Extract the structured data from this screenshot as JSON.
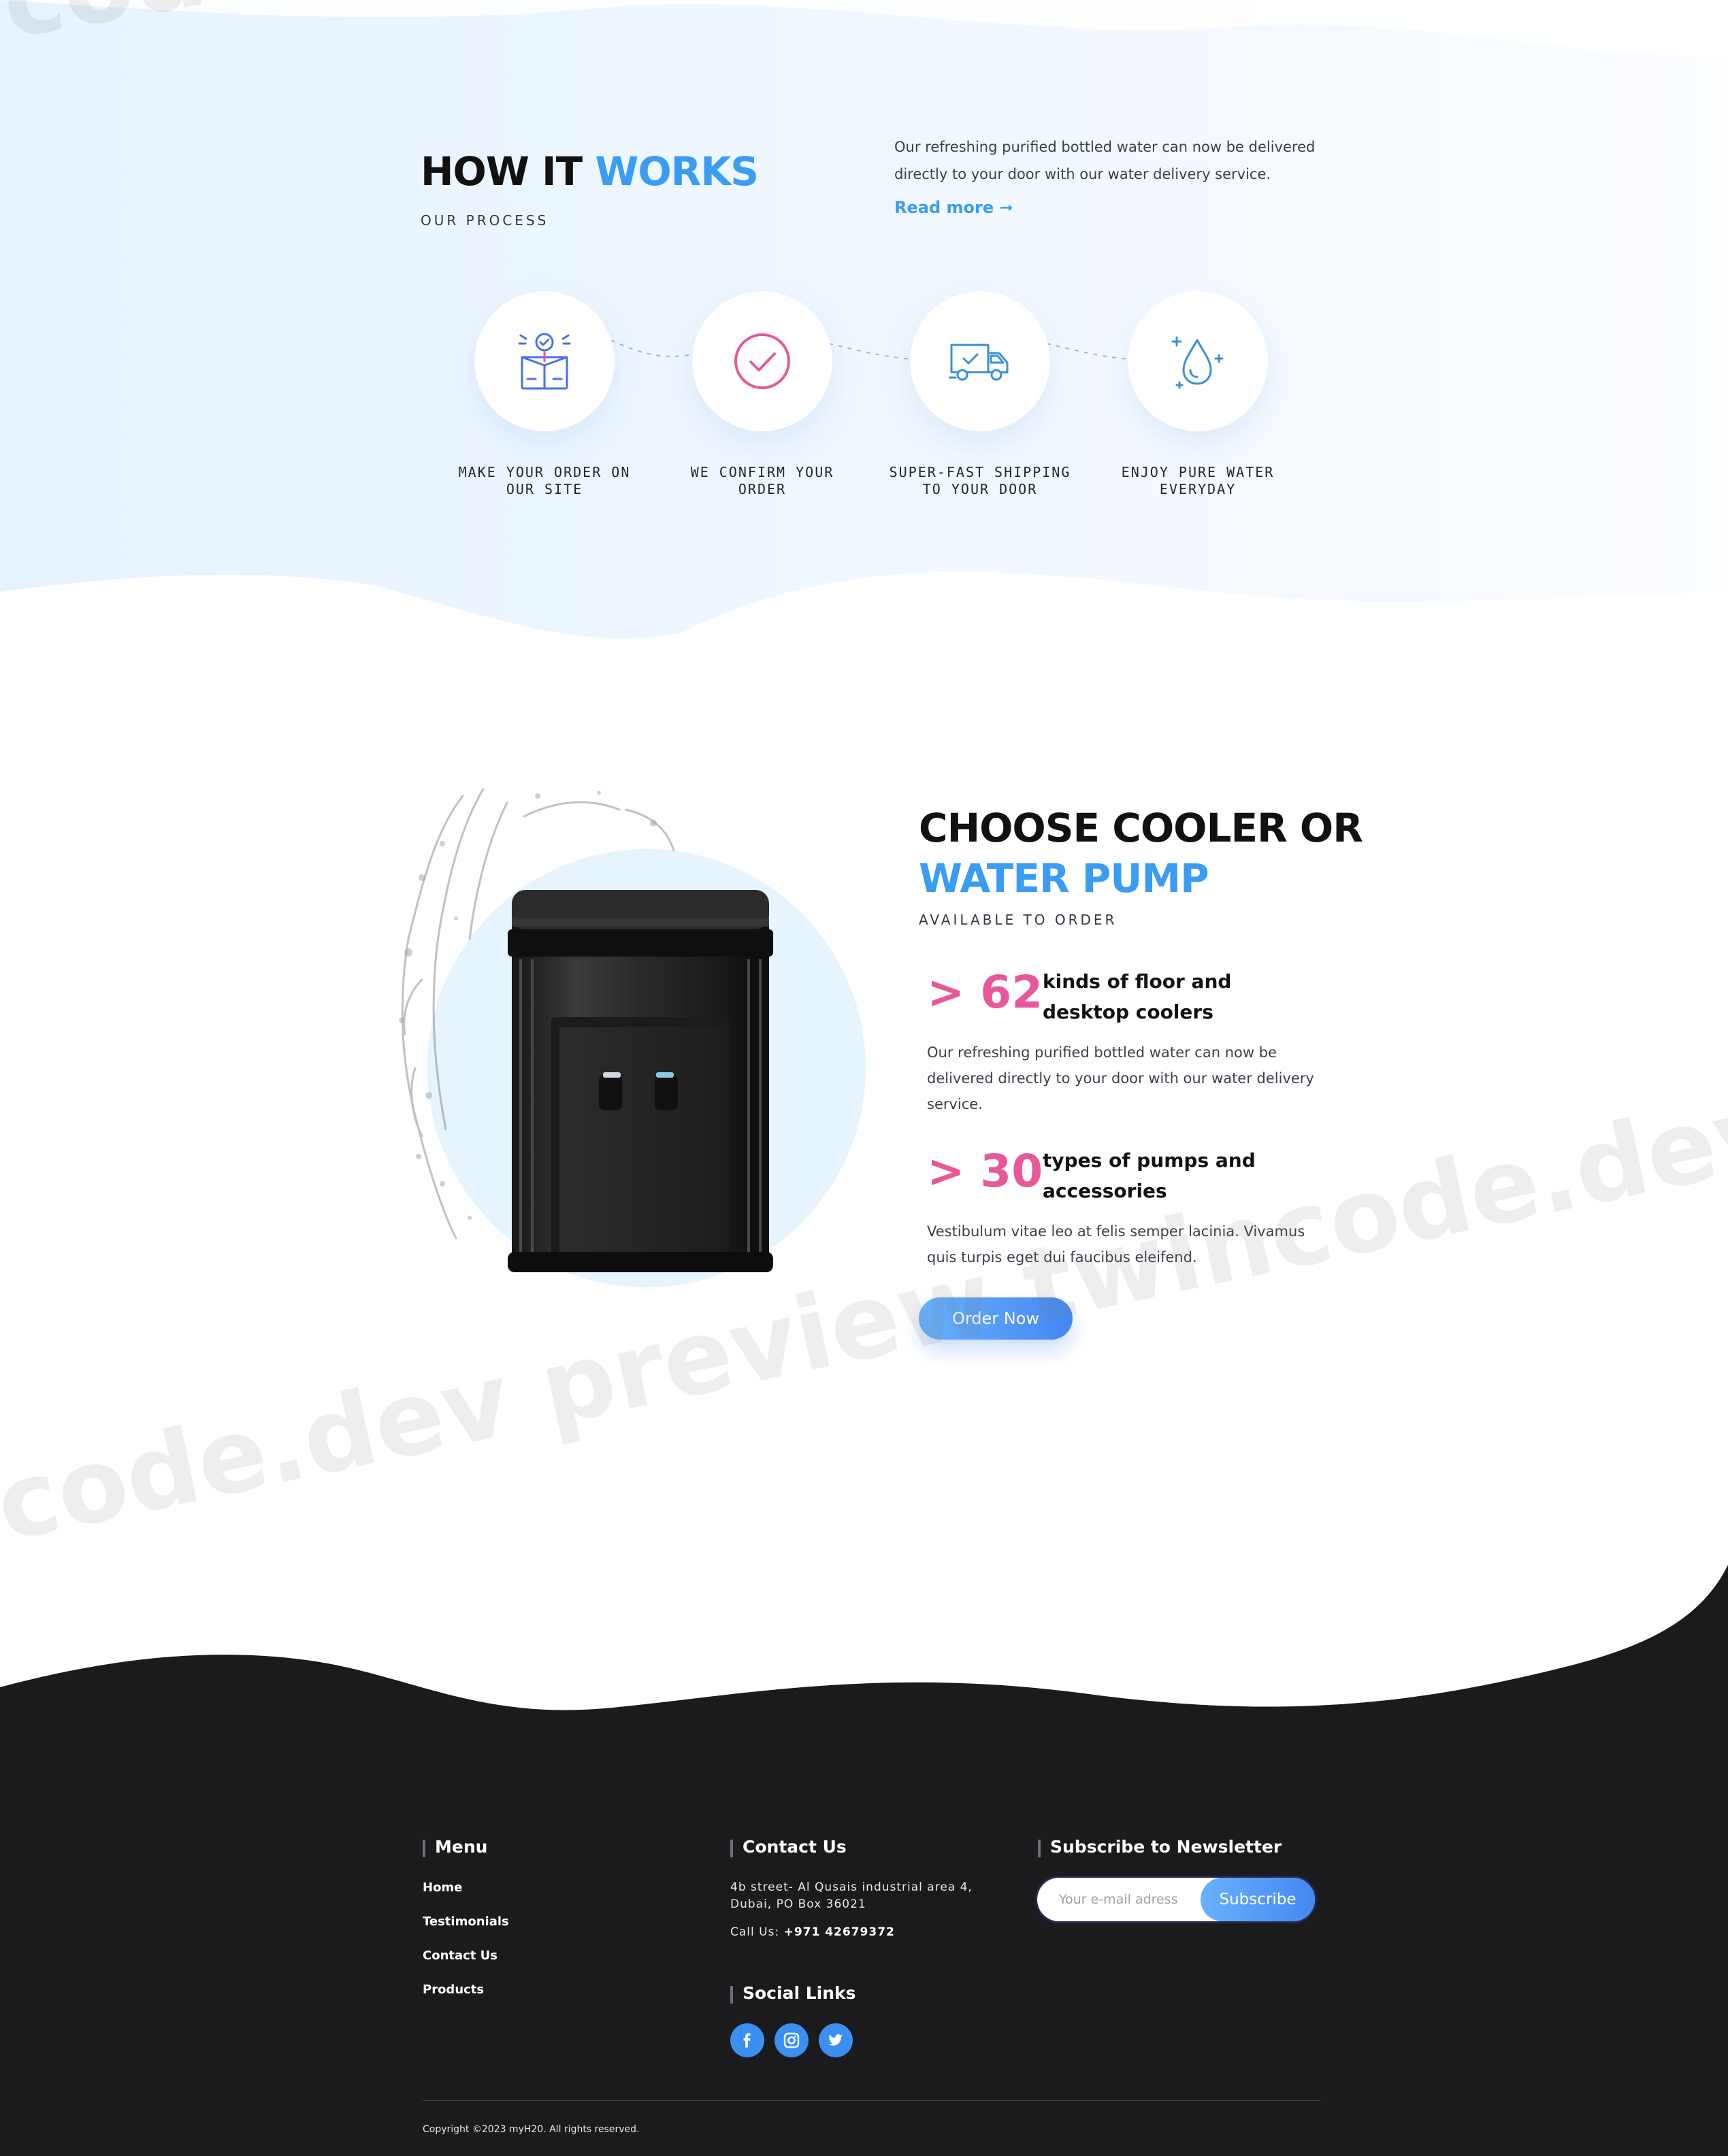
{
  "how_it_works": {
    "title_part1": "HOW IT",
    "title_part2": "WORKS",
    "subtitle": "OUR PROCESS",
    "description": "Our refreshing purified bottled water can now be delivered directly to your door with our water delivery service.",
    "read_more": "Read more ➞",
    "steps": [
      {
        "icon": "box-check-icon",
        "label_line1": "MAKE YOUR ORDER ON",
        "label_line2": "OUR SITE"
      },
      {
        "icon": "check-circle-icon",
        "label_line1": "WE CONFIRM YOUR",
        "label_line2": "ORDER"
      },
      {
        "icon": "delivery-truck-icon",
        "label_line1": "SUPER-FAST SHIPPING",
        "label_line2": "TO YOUR DOOR"
      },
      {
        "icon": "water-drop-icon",
        "label_line1": "ENJOY PURE WATER",
        "label_line2": "EVERYDAY"
      }
    ]
  },
  "cooler": {
    "title_line1": "CHOOSE COOLER OR",
    "title_line2": "WATER PUMP",
    "subtitle": "AVAILABLE TO ORDER",
    "stats": [
      {
        "number": "> 62",
        "text": "kinds of floor and desktop coolers",
        "description": "Our refreshing purified bottled water can now be delivered directly to your door with our water delivery service."
      },
      {
        "number": "> 30",
        "text": "types of pumps and accessories",
        "description": "Vestibulum vitae leo at felis semper lacinia. Vivamus quis turpis eget dui faucibus eleifend."
      }
    ],
    "order_button": "Order Now"
  },
  "watermark": {
    "top": "code.",
    "middle": "code.dev preview  twincode.dev preview"
  },
  "footer": {
    "menu": {
      "heading": "Menu",
      "items": [
        "Home",
        "Testimonials",
        "Contact Us",
        "Products"
      ]
    },
    "contact": {
      "heading": "Contact Us",
      "address": "4b street- Al Qusais industrial area 4, Dubai, PO Box 36021",
      "call_label": "Call Us:",
      "phone": "+971 42679372"
    },
    "newsletter": {
      "heading": "Subscribe to Newsletter",
      "placeholder": "Your e-mail adress",
      "button": "Subscribe"
    },
    "social": {
      "heading": "Social Links",
      "icons": [
        "facebook-icon",
        "instagram-icon",
        "twitter-icon"
      ]
    },
    "copyright": "Copyright ©2023 myH20. All rights reserved."
  },
  "colors": {
    "accent_blue": "#3a9cf2",
    "accent_pink": "#e8579a",
    "footer_bg": "#1b1b1d",
    "button_gradient_start": "#69b1fb",
    "button_gradient_end": "#4487f3"
  }
}
